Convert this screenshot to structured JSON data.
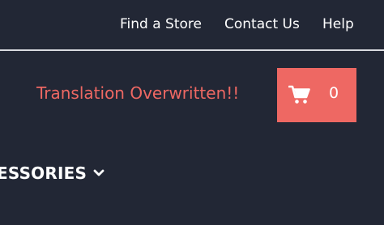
{
  "top_nav": {
    "find_store": "Find a Store",
    "contact_us": "Contact Us",
    "help": "Help"
  },
  "promo": {
    "message": "Translation Overwritten!!"
  },
  "cart": {
    "icon": "shopping-cart-icon",
    "count": "0"
  },
  "category_nav": {
    "label": "ESSORIES",
    "icon": "chevron-down-icon"
  },
  "colors": {
    "background": "#222735",
    "accent": "#ee6863",
    "divider": "#d9dbe0",
    "text": "#ffffff"
  }
}
